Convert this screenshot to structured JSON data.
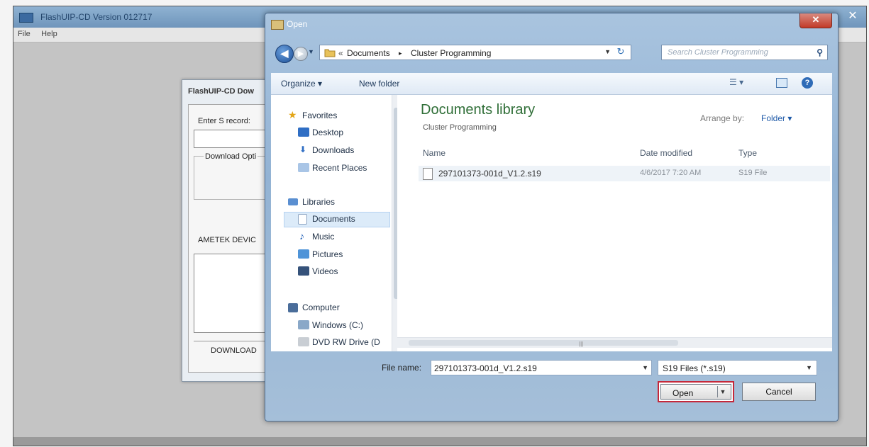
{
  "app": {
    "title": "FlashUIP-CD Version 012717",
    "menu": [
      "File",
      "Help"
    ],
    "download_dialog": {
      "title": "FlashUIP-CD Dow",
      "srecord_label": "Enter S record:",
      "download_options_label": "Download Opti",
      "ametek_label": "AMETEK DEVIC",
      "download_button": "DOWNLOAD"
    }
  },
  "open_dialog": {
    "title": "Open",
    "address": {
      "prefix": "«",
      "crumbs": [
        "Documents",
        "Cluster Programming"
      ],
      "separator": "▸"
    },
    "search_placeholder": "Search Cluster Programming",
    "toolbar": {
      "organize": "Organize ▾",
      "new_folder": "New folder"
    },
    "nav": {
      "favorites": "Favorites",
      "desktop": "Desktop",
      "downloads": "Downloads",
      "recent_places": "Recent Places",
      "libraries": "Libraries",
      "documents": "Documents",
      "music": "Music",
      "pictures": "Pictures",
      "videos": "Videos",
      "computer": "Computer",
      "windows_c": "Windows (C:)",
      "dvd_drive": "DVD RW Drive (D"
    },
    "library": {
      "title": "Documents library",
      "subtitle": "Cluster Programming",
      "arrange_by_label": "Arrange by:",
      "arrange_by_value": "Folder ▾"
    },
    "columns": [
      "Name",
      "Date modified",
      "Type"
    ],
    "files": [
      {
        "name": "297101373-001d_V1.2.s19",
        "date": "4/6/2017 7:20 AM",
        "type": "S19 File"
      }
    ],
    "filename_label": "File name:",
    "filename_value": "297101373-001d_V1.2.s19",
    "filetype_value": "S19 Files (*.s19)",
    "open_button": "Open",
    "cancel_button": "Cancel",
    "colors": {
      "highlight_border": "#c4283a",
      "library_title": "#2f6e37",
      "link_blue": "#1f5aa8"
    }
  }
}
